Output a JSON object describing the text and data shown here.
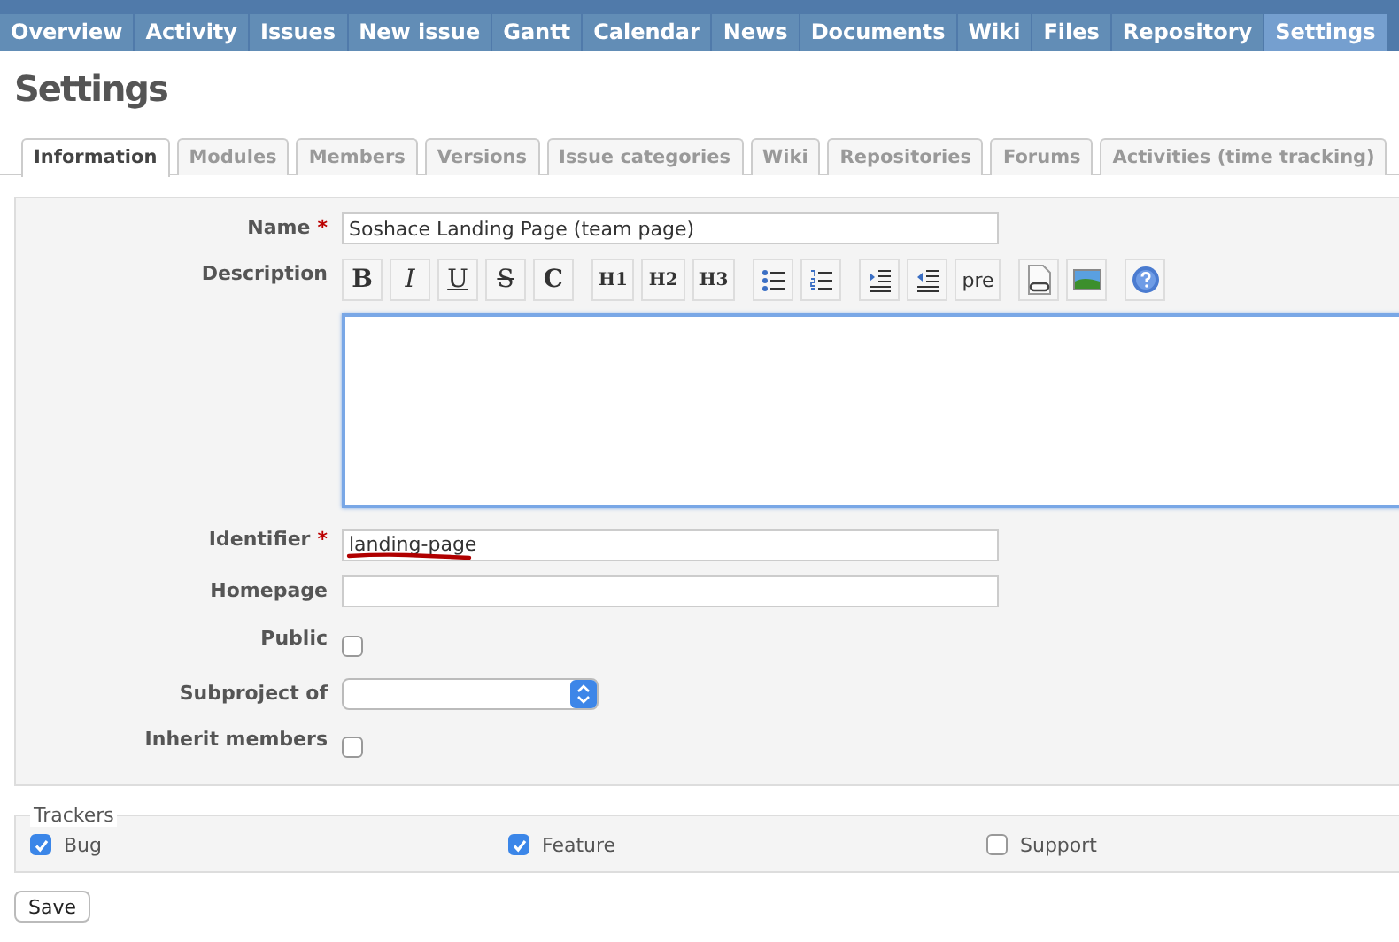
{
  "main_menu": [
    {
      "label": "Overview",
      "selected": false
    },
    {
      "label": "Activity",
      "selected": false
    },
    {
      "label": "Issues",
      "selected": false
    },
    {
      "label": "New issue",
      "selected": false
    },
    {
      "label": "Gantt",
      "selected": false
    },
    {
      "label": "Calendar",
      "selected": false
    },
    {
      "label": "News",
      "selected": false
    },
    {
      "label": "Documents",
      "selected": false
    },
    {
      "label": "Wiki",
      "selected": false
    },
    {
      "label": "Files",
      "selected": false
    },
    {
      "label": "Repository",
      "selected": false
    },
    {
      "label": "Settings",
      "selected": true
    }
  ],
  "page_title": "Settings",
  "tabs": [
    {
      "label": "Information",
      "selected": true
    },
    {
      "label": "Modules",
      "selected": false
    },
    {
      "label": "Members",
      "selected": false
    },
    {
      "label": "Versions",
      "selected": false
    },
    {
      "label": "Issue categories",
      "selected": false
    },
    {
      "label": "Wiki",
      "selected": false
    },
    {
      "label": "Repositories",
      "selected": false
    },
    {
      "label": "Forums",
      "selected": false
    },
    {
      "label": "Activities (time tracking)",
      "selected": false
    }
  ],
  "form": {
    "name": {
      "label": "Name",
      "required_mark": "*",
      "value": "Soshace Landing Page (team page)"
    },
    "description": {
      "label": "Description",
      "toolbar": [
        [
          {
            "kind": "text",
            "label": "B"
          },
          {
            "kind": "text",
            "label": "I"
          },
          {
            "kind": "text",
            "label": "U"
          },
          {
            "kind": "text",
            "label": "S"
          },
          {
            "kind": "text",
            "label": "C"
          }
        ],
        [
          {
            "kind": "text",
            "label": "H1"
          },
          {
            "kind": "text",
            "label": "H2"
          },
          {
            "kind": "text",
            "label": "H3"
          }
        ],
        [
          {
            "kind": "ul"
          },
          {
            "kind": "ol"
          }
        ],
        [
          {
            "kind": "indent"
          },
          {
            "kind": "outdent"
          },
          {
            "kind": "text",
            "label": "pre"
          }
        ],
        [
          {
            "kind": "link"
          },
          {
            "kind": "image"
          }
        ],
        [
          {
            "kind": "help"
          }
        ]
      ]
    },
    "identifier": {
      "label": "Identifier",
      "required_mark": "*",
      "value": "landing-page"
    },
    "homepage": {
      "label": "Homepage"
    },
    "public": {
      "label": "Public",
      "checked": false
    },
    "subproject_of": {
      "label": "Subproject of"
    },
    "inherit_members": {
      "label": "Inherit members",
      "checked": false
    }
  },
  "trackers": {
    "legend": "Trackers",
    "items": [
      {
        "label": "Bug",
        "checked": true
      },
      {
        "label": "Feature",
        "checked": true
      },
      {
        "label": "Support",
        "checked": false
      }
    ]
  },
  "save_button": "Save"
}
